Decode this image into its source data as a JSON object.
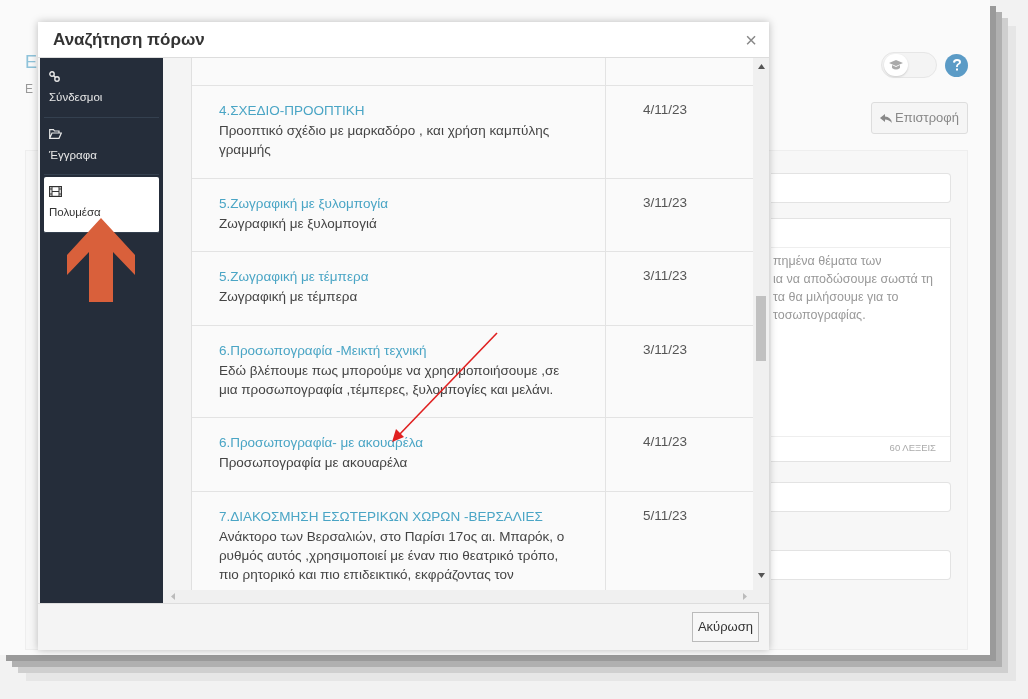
{
  "background_page": {
    "title_fragment": "Ε",
    "subtitle_fragment": "Ε",
    "toggle": {
      "on": false
    },
    "back_button": "Επιστροφή",
    "description_lines": [
      "πημένα θέματα των",
      "ια να αποδώσουμε σωστά τη",
      "τα θα μιλήσουμε για το",
      "τοσωπογραφίας."
    ],
    "word_count": "60 ΛΕΞΕΙΣ"
  },
  "modal": {
    "title": "Αναζήτηση πόρων",
    "close_button": "×",
    "sidebar": {
      "items": [
        {
          "label": "Σύνδεσμοι",
          "kind": "link",
          "selected": false
        },
        {
          "label": "Έγγραφα",
          "kind": "folder",
          "selected": false
        },
        {
          "label": "Πολυμέσα",
          "kind": "film",
          "selected": true
        }
      ]
    },
    "resources": [
      {
        "title": "4.ΣΧΕΔΙΟ-ΠΡΟΟΠΤΙΚΗ",
        "description": "Προοπτικό σχέδιο με μαρκαδόρο , και χρήση καμπύλης γραμμής",
        "date": "4/11/23"
      },
      {
        "title": "5.Ζωγραφική με ξυλομπογία",
        "description": "Ζωγραφική με ξυλομπογιά",
        "date": "3/11/23"
      },
      {
        "title": "5.Ζωγραφική με τέμπερα",
        "description": "Ζωγραφική με τέμπερα",
        "date": "3/11/23"
      },
      {
        "title": "6.Προσωπογραφία -Μεικτή τεχνική",
        "description": "Εδώ βλέπουμε πως μπορούμε να χρησιμοποιήσουμε ,σε μια προσωπογραφία ,τέμπερες, ξυλομπογίες και μελάνι.",
        "date": "3/11/23"
      },
      {
        "title": "6.Προσωπογραφία- με ακουαρέλα",
        "description": "Προσωπογραφία με ακουαρέλα",
        "date": "4/11/23"
      },
      {
        "title": "7.ΔΙΑΚΟΣΜΗΣΗ ΕΣΩΤΕΡΙΚΩΝ ΧΩΡΩΝ -ΒΕΡΣΑΛΙΕΣ",
        "description": "Ανάκτορο των Βερσαλιών, στο Παρίσι 17ος αι. Μπαρόκ, ο ρυθμός αυτός ,χρησιμοποιεί με έναν πιο θεατρικό τρόπο, πιο ρητορικό και πιο επιδεικτικό, εκφράζοντας τον",
        "date": "5/11/23"
      }
    ],
    "cancel_button": "Ακύρωση"
  },
  "annotations": [
    {
      "kind": "block-arrow",
      "color": "#d9603b"
    },
    {
      "kind": "line-arrow",
      "color": "#e02020"
    }
  ]
}
